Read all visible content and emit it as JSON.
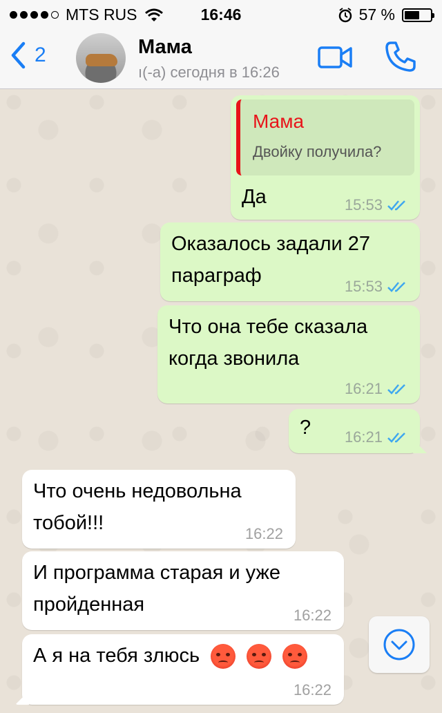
{
  "status_bar": {
    "carrier": "MTS RUS",
    "time": "16:46",
    "battery": "57 %",
    "battery_level": 0.57
  },
  "header": {
    "back_count": "2",
    "contact_name": "Мама",
    "contact_status": "ı(-а) сегодня в 16:26"
  },
  "messages": [
    {
      "direction": "outgoing",
      "quote_author": "Мама",
      "quote_text": "Двойку получила?",
      "line1": "Да",
      "time": "15:53",
      "status": "read"
    },
    {
      "direction": "outgoing",
      "line1": "Оказалось задали 27",
      "line2": "параграф",
      "time": "15:53",
      "status": "read"
    },
    {
      "direction": "outgoing",
      "line1": "Что она тебе сказала",
      "line2": "когда звонила",
      "time": "16:21",
      "status": "read"
    },
    {
      "direction": "outgoing",
      "line1": "?",
      "time": "16:21",
      "status": "read"
    },
    {
      "direction": "incoming",
      "line1": "Что очень недовольна",
      "line2": "тобой!!!",
      "time": "16:22"
    },
    {
      "direction": "incoming",
      "line1": "И программа старая и уже",
      "line2": "пройденная",
      "time": "16:22"
    },
    {
      "direction": "incoming",
      "line1": "А я на тебя злюсь",
      "emoji": "angry-face x3",
      "time": "16:22"
    }
  ],
  "colors": {
    "accent": "#1a7ef5",
    "outgoing_bubble": "#dcf8c6",
    "incoming_bubble": "#ffffff",
    "quote_author": "#e8141a",
    "read_ticks": "#3fa7ef"
  }
}
